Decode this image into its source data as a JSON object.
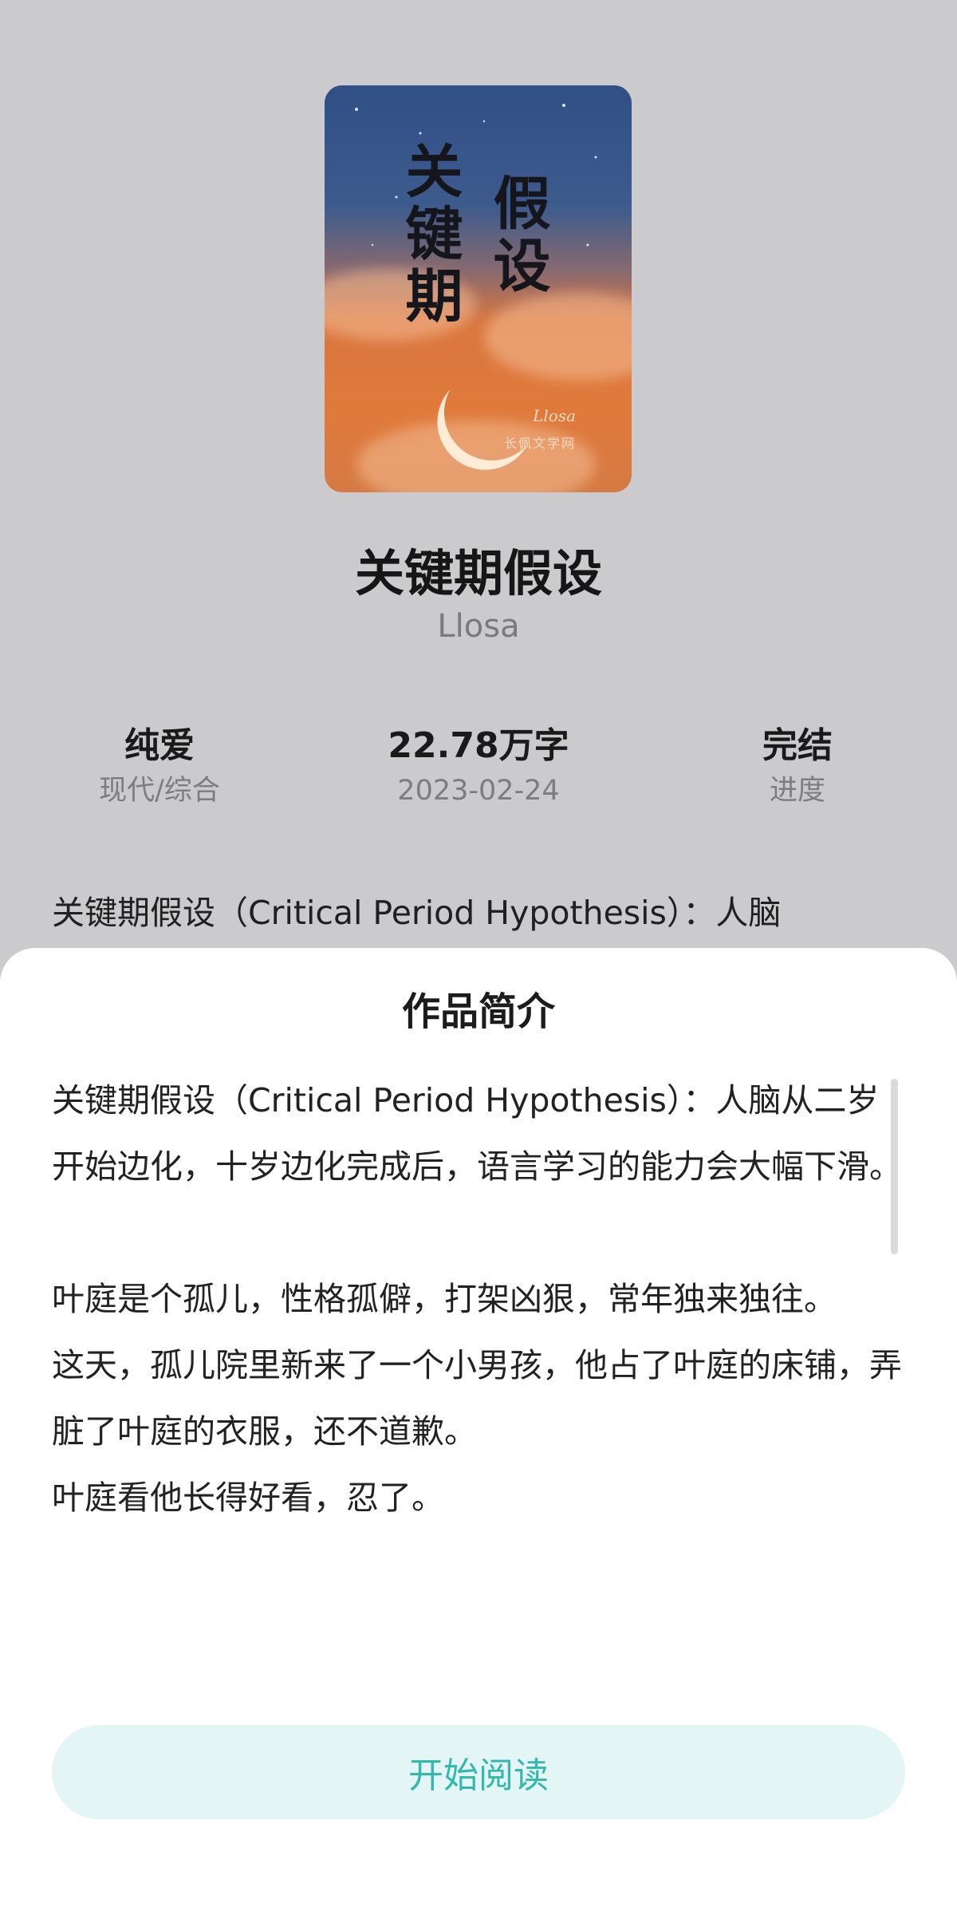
{
  "book": {
    "cover": {
      "calligraphy_left": "关键期",
      "calligraphy_right": "假设",
      "signature": "Llosa",
      "site": "长佩文学网"
    },
    "title": "关键期假设",
    "author": "Llosa",
    "stats": [
      {
        "value": "纯爱",
        "label": "现代/综合"
      },
      {
        "value": "22.78万字",
        "label": "2023-02-24"
      },
      {
        "value": "完结",
        "label": "进度"
      }
    ],
    "intro_preview": "关键期假设（Critical Period Hypothesis）：人脑"
  },
  "sheet": {
    "title": "作品简介",
    "paragraphs": [
      "关键期假设（Critical Period Hypothesis）：人脑从二岁开始边化，十岁边化完成后，语言学习的能力会大幅下滑。",
      "",
      "叶庭是个孤儿，性格孤僻，打架凶狠，常年独来独往。",
      "这天，孤儿院里新来了一个小男孩，他占了叶庭的床铺，弄脏了叶庭的衣服，还不道歉。",
      "叶庭看他长得好看，忍了。"
    ],
    "read_button": "开始阅读"
  },
  "colors": {
    "overlay_bg": "#cbcbcd",
    "accent": "#35b7ad",
    "button_bg": "#e3f6f5"
  }
}
